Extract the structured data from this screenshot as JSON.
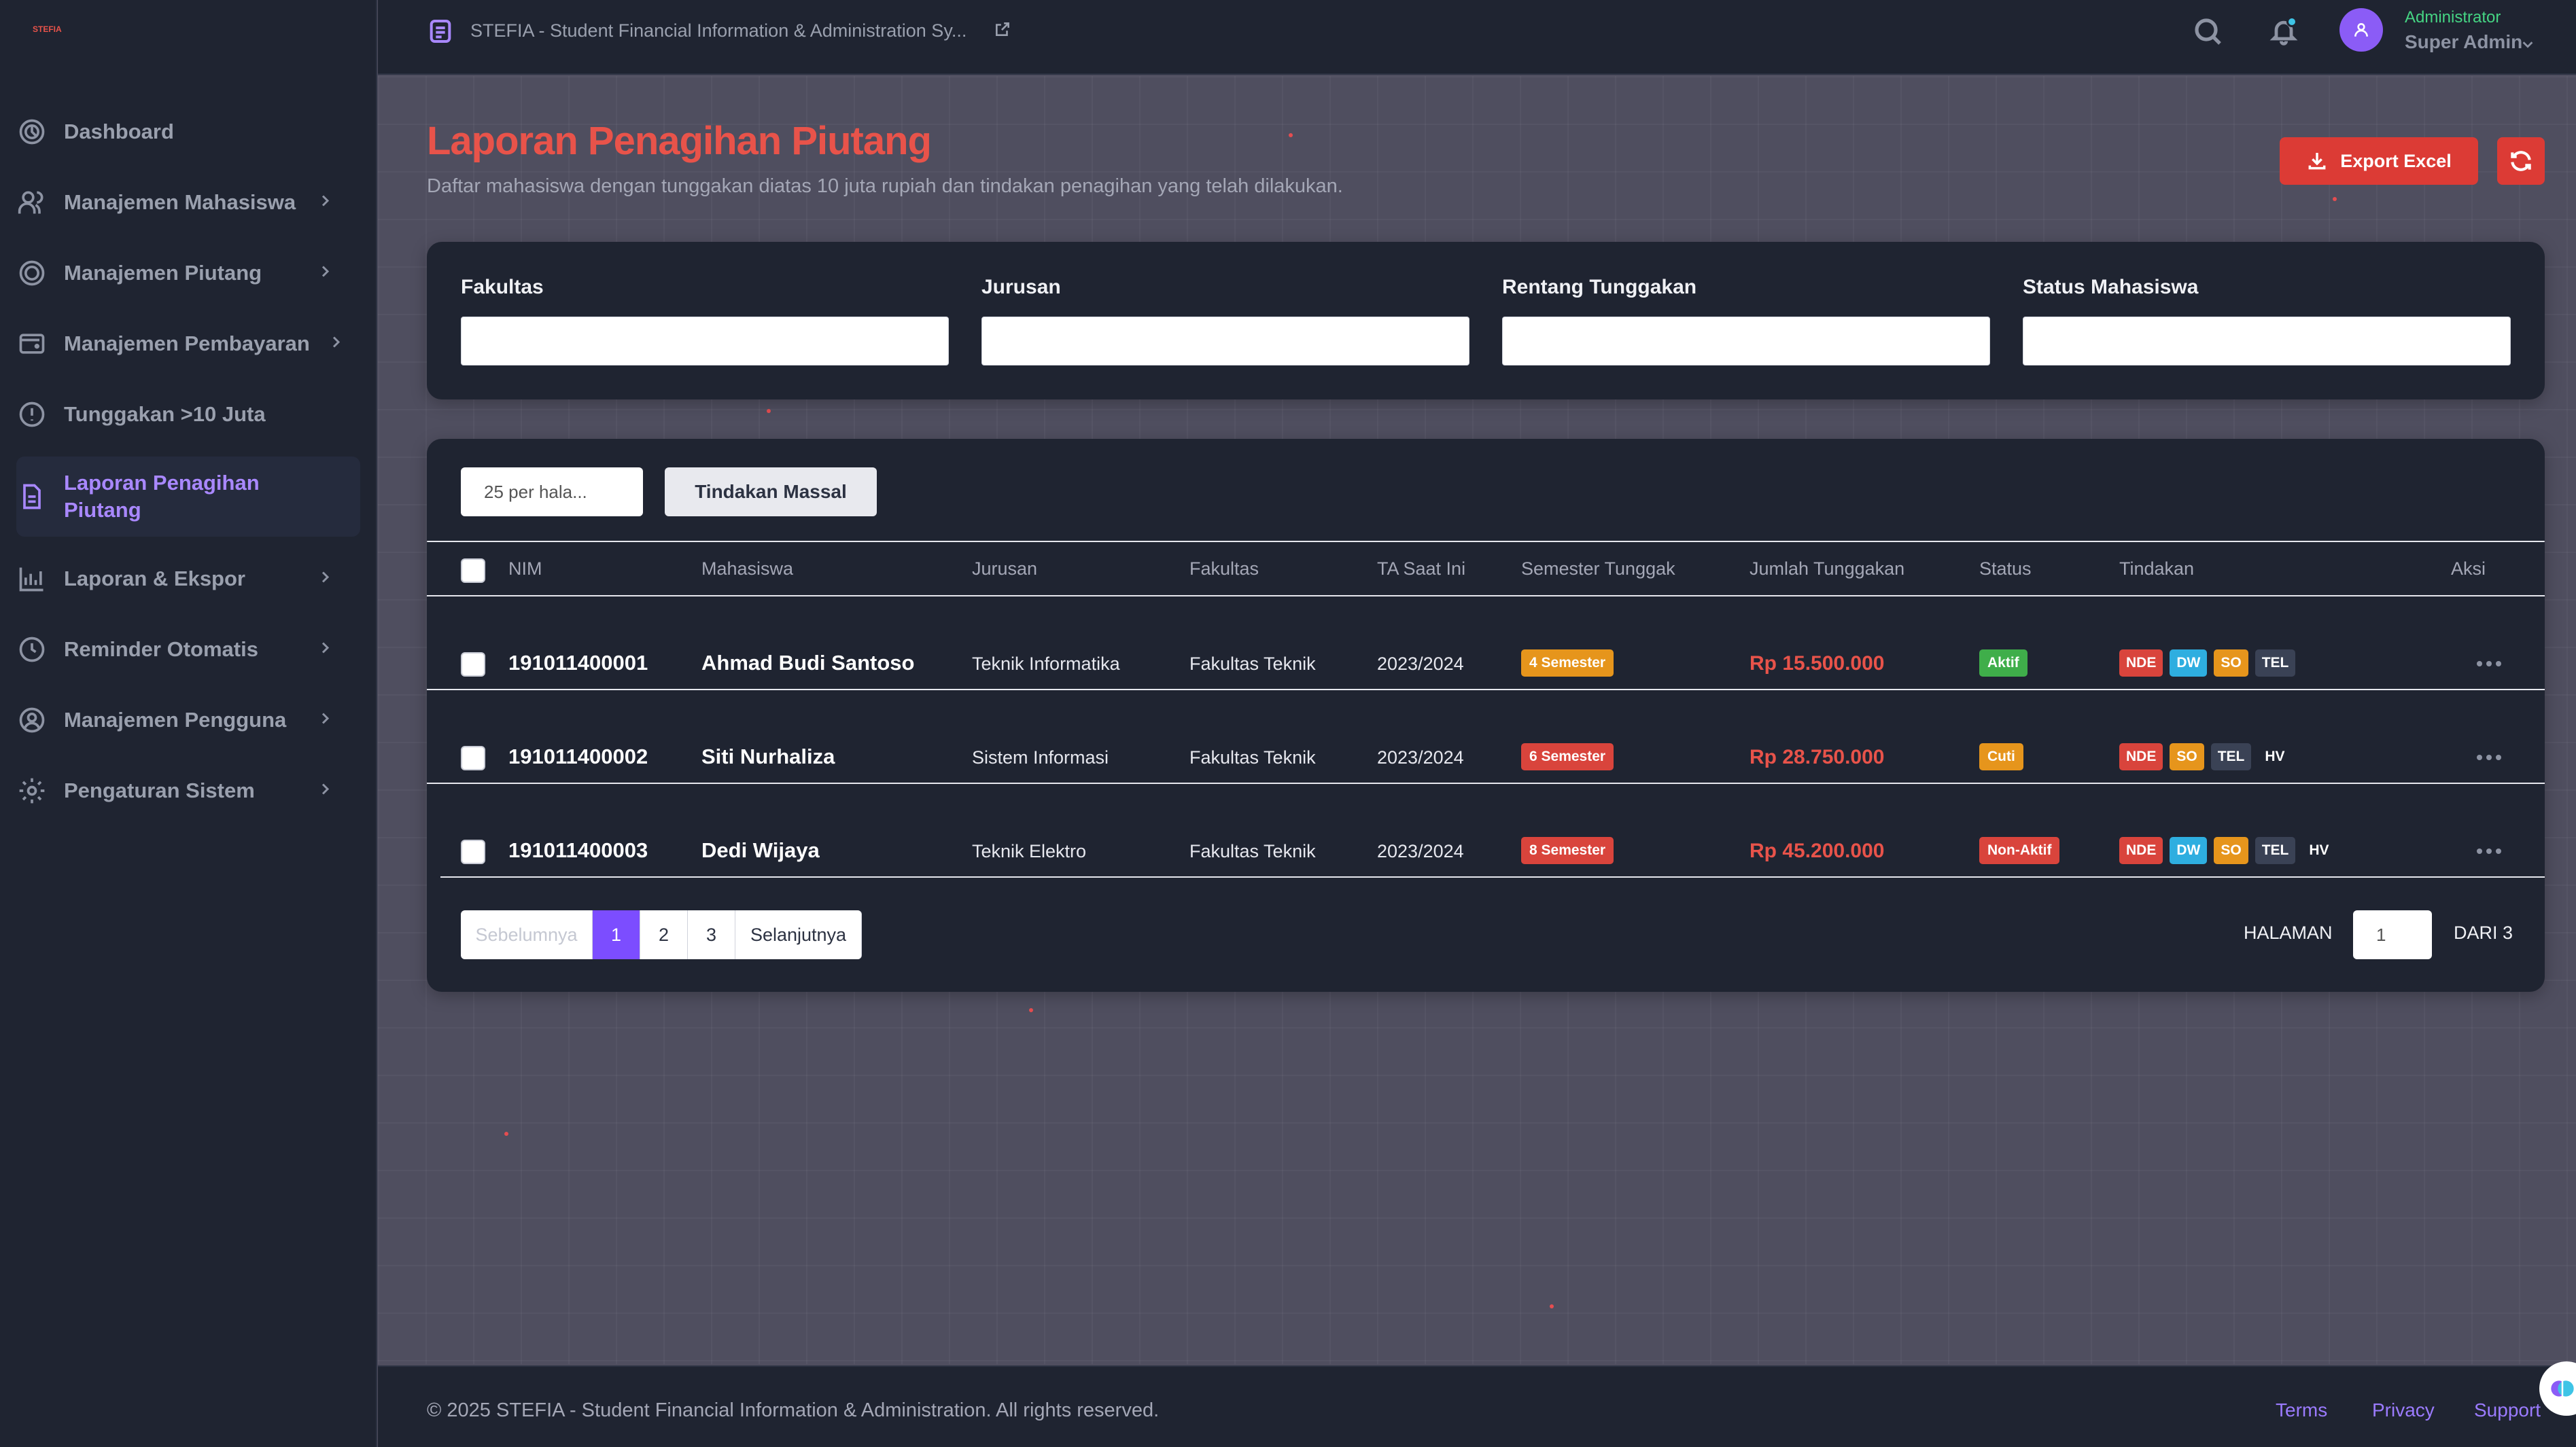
{
  "app": {
    "logo_text": "STEFIA",
    "title": "STEFIA - Student Financial Information & Administration Sy..."
  },
  "user": {
    "role": "Administrator",
    "name": "Super Admin"
  },
  "sidebar": {
    "items": [
      {
        "label": "Dashboard",
        "icon": "dashboard-icon",
        "chevron": false
      },
      {
        "label": "Manajemen Mahasiswa",
        "icon": "users-icon",
        "chevron": true
      },
      {
        "label": "Manajemen Piutang",
        "icon": "coins-icon",
        "chevron": true
      },
      {
        "label": "Manajemen Pembayaran",
        "icon": "wallet-icon",
        "chevron": true
      },
      {
        "label": "Tunggakan >10 Juta",
        "icon": "alert-circle-icon",
        "chevron": false
      },
      {
        "label": "Laporan Penagihan Piutang",
        "icon": "document-icon",
        "chevron": false,
        "active": true
      },
      {
        "label": "Laporan & Ekspor",
        "icon": "bar-chart-icon",
        "chevron": true
      },
      {
        "label": "Reminder Otomatis",
        "icon": "clock-icon",
        "chevron": true
      },
      {
        "label": "Manajemen Pengguna",
        "icon": "user-circle-icon",
        "chevron": true
      },
      {
        "label": "Pengaturan Sistem",
        "icon": "gear-icon",
        "chevron": true
      }
    ]
  },
  "page": {
    "title": "Laporan Penagihan Piutang",
    "subtitle": "Daftar mahasiswa dengan tunggakan diatas 10 juta rupiah dan tindakan penagihan yang telah dilakukan.",
    "export_label": "Export Excel"
  },
  "filters": {
    "fakultas": {
      "label": "Fakultas",
      "value": ""
    },
    "jurusan": {
      "label": "Jurusan",
      "value": ""
    },
    "rentang": {
      "label": "Rentang Tunggakan",
      "value": ""
    },
    "status": {
      "label": "Status Mahasiswa",
      "value": ""
    }
  },
  "table_controls": {
    "per_page": "25 per hala...",
    "mass_action": "Tindakan Massal"
  },
  "table": {
    "headers": {
      "nim": "NIM",
      "mahasiswa": "Mahasiswa",
      "jurusan": "Jurusan",
      "fakultas": "Fakultas",
      "ta": "TA Saat Ini",
      "semester": "Semester Tunggak",
      "jumlah": "Jumlah Tunggakan",
      "status": "Status",
      "tindakan": "Tindakan",
      "aksi": "Aksi"
    },
    "rows": [
      {
        "nim": "191011400001",
        "name": "Ahmad Budi Santoso",
        "jurusan": "Teknik Informatika",
        "fakultas": "Fakultas Teknik",
        "ta": "2023/2024",
        "semester": "4 Semester",
        "semester_color": "#e6951c",
        "jumlah": "Rp 15.500.000",
        "status": "Aktif",
        "status_color": "#3fae4a",
        "tindakan": [
          "NDE",
          "DW",
          "SO",
          "TEL"
        ]
      },
      {
        "nim": "191011400002",
        "name": "Siti Nurhaliza",
        "jurusan": "Sistem Informasi",
        "fakultas": "Fakultas Teknik",
        "ta": "2023/2024",
        "semester": "6 Semester",
        "semester_color": "#d9443c",
        "jumlah": "Rp 28.750.000",
        "status": "Cuti",
        "status_color": "#e6951c",
        "tindakan": [
          "NDE",
          "SO",
          "TEL",
          "HV"
        ]
      },
      {
        "nim": "191011400003",
        "name": "Dedi Wijaya",
        "jurusan": "Teknik Elektro",
        "fakultas": "Fakultas Teknik",
        "ta": "2023/2024",
        "semester": "8 Semester",
        "semester_color": "#d9443c",
        "jumlah": "Rp 45.200.000",
        "status": "Non-Aktif",
        "status_color": "#d9443c",
        "tindakan": [
          "NDE",
          "DW",
          "SO",
          "TEL",
          "HV"
        ]
      }
    ]
  },
  "pagination": {
    "prev": "Sebelumnya",
    "pages": [
      "1",
      "2",
      "3"
    ],
    "current": "1",
    "next": "Selanjutnya",
    "halaman_label": "HALAMAN",
    "page_value": "1",
    "of_label": "DARI 3"
  },
  "footer": {
    "copyright": "© 2025 STEFIA - Student Financial Information & Administration. All rights reserved.",
    "terms": "Terms",
    "privacy": "Privacy",
    "support": "Support"
  }
}
